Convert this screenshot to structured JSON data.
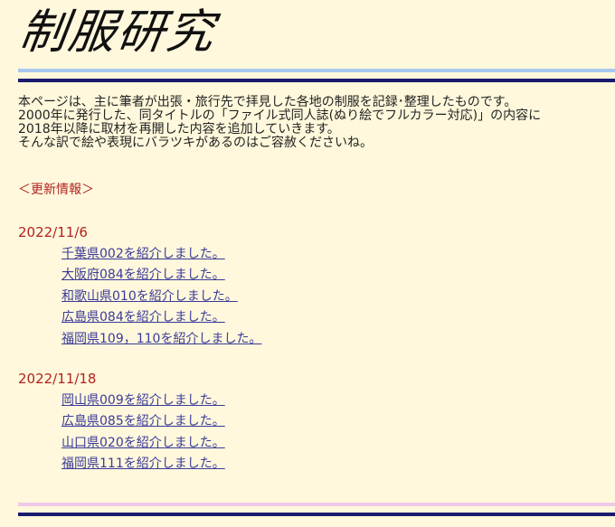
{
  "header": {
    "title": "制服研究"
  },
  "intro": {
    "lines": [
      "本ページは、主に筆者が出張・旅行先で拝見した各地の制服を記録･整理したものです。",
      "2000年に発行した、同タイトルの「ファイル式同人誌(ぬり絵でフルカラー対応)」の内容に",
      "2018年以降に取材を再開した内容を追加していきます。",
      "そんな訳で絵や表現にバラツキがあるのはご容赦くださいね。"
    ]
  },
  "news": {
    "heading": "＜更新情報＞",
    "updates": [
      {
        "date": "2022/11/6",
        "items": [
          "千葉県002を紹介しました。",
          "大阪府084を紹介しました。",
          "和歌山県010を紹介しました。",
          "広島県084を紹介しました。",
          "福岡県109，110を紹介しました。"
        ]
      },
      {
        "date": "2022/11/18",
        "items": [
          "岡山県009を紹介しました。",
          "広島県085を紹介しました。",
          "山口県020を紹介しました。",
          "福岡県111を紹介しました。"
        ]
      }
    ]
  },
  "colors": {
    "background": "#fff8dc",
    "top_rule_light": "#a8c8f0",
    "rule_dark": "#1a1a6e",
    "bottom_rule_light": "#f0c8e8",
    "date_and_heading": "#b22222",
    "link": "#3a3a99"
  }
}
